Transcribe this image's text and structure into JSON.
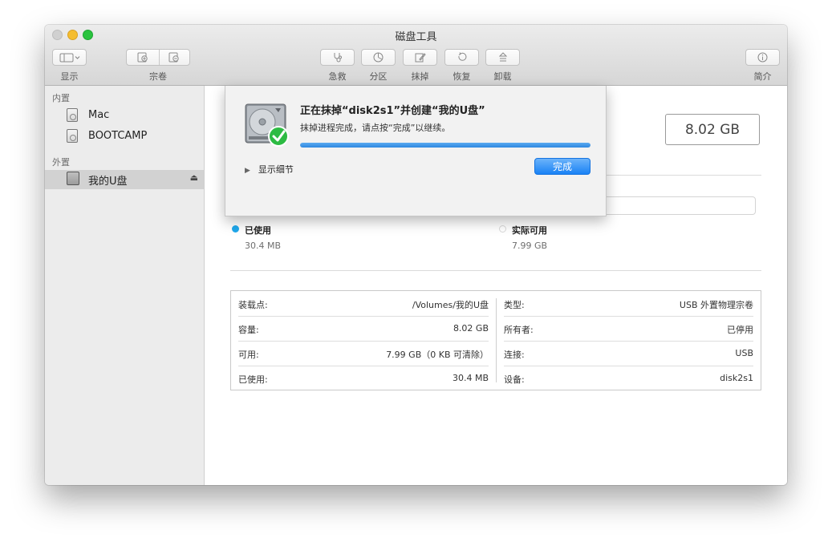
{
  "window": {
    "title": "磁盘工具"
  },
  "toolbar": {
    "display_label": "显示",
    "volume_label": "宗卷",
    "rescue_label": "急救",
    "partition_label": "分区",
    "erase_label": "抹掉",
    "restore_label": "恢复",
    "unmount_label": "卸载",
    "info_label": "简介"
  },
  "sidebar": {
    "internal_header": "内置",
    "external_header": "外置",
    "internal_items": [
      {
        "label": "Mac"
      },
      {
        "label": "BOOTCAMP"
      }
    ],
    "external_items": [
      {
        "label": "我的U盘",
        "selected": true
      }
    ]
  },
  "main": {
    "capacity": "8.02 GB",
    "usage": {
      "used_fraction": 0.004,
      "used_color": "#1fa8ec",
      "used_title": "已使用",
      "used_value": "30.4 MB",
      "free_title": "实际可用",
      "free_value": "7.99 GB"
    },
    "info": {
      "left": [
        {
          "key": "装载点:",
          "value": "/Volumes/我的U盘"
        },
        {
          "key": "容量:",
          "value": "8.02 GB"
        },
        {
          "key": "可用:",
          "value": "7.99 GB（0 KB 可清除）"
        },
        {
          "key": "已使用:",
          "value": "30.4 MB"
        }
      ],
      "right": [
        {
          "key": "类型:",
          "value": "USB 外置物理宗卷"
        },
        {
          "key": "所有者:",
          "value": "已停用"
        },
        {
          "key": "连接:",
          "value": "USB"
        },
        {
          "key": "设备:",
          "value": "disk2s1"
        }
      ]
    }
  },
  "sheet": {
    "title": "正在抹掉“disk2s1”并创建“我的U盘”",
    "subtitle": "抹掉进程完成，请点按“完成”以继续。",
    "progress": 1.0,
    "details_label": "显示细节",
    "done_label": "完成"
  }
}
